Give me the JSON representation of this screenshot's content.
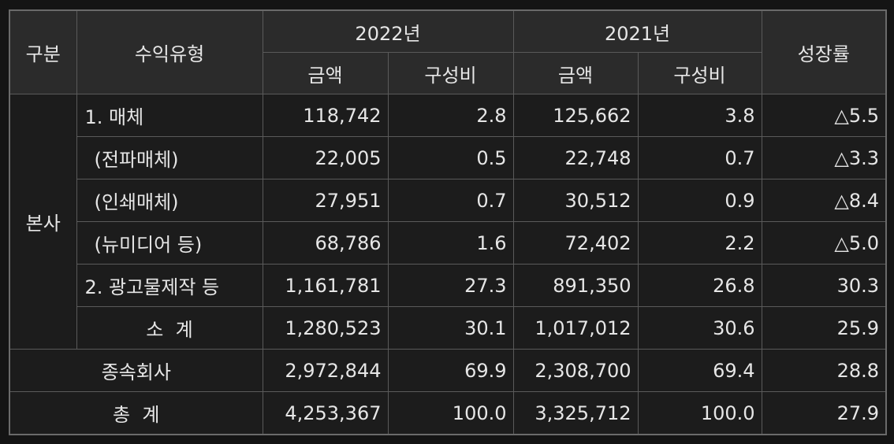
{
  "header": {
    "division": "구분",
    "revenue_type": "수익유형",
    "year_2022": "2022년",
    "year_2021": "2021년",
    "growth": "성장률",
    "amount_2022": "금액",
    "ratio_2022": "구성비",
    "amount_2021": "금액",
    "ratio_2021": "구성비"
  },
  "group_label": "본사",
  "rows": [
    {
      "label": "1. 매체",
      "amt22": "118,742",
      "ratio22": "2.8",
      "amt21": "125,662",
      "ratio21": "3.8",
      "growth": "△5.5"
    },
    {
      "label": "(전파매체)",
      "amt22": "22,005",
      "ratio22": "0.5",
      "amt21": "22,748",
      "ratio21": "0.7",
      "growth": "△3.3"
    },
    {
      "label": "(인쇄매체)",
      "amt22": "27,951",
      "ratio22": "0.7",
      "amt21": "30,512",
      "ratio21": "0.9",
      "growth": "△8.4"
    },
    {
      "label": "(뉴미디어 등)",
      "amt22": "68,786",
      "ratio22": "1.6",
      "amt21": "72,402",
      "ratio21": "2.2",
      "growth": "△5.0"
    },
    {
      "label": "2. 광고물제작 등",
      "amt22": "1,161,781",
      "ratio22": "27.3",
      "amt21": "891,350",
      "ratio21": "26.8",
      "growth": "30.3"
    },
    {
      "label": "소  계",
      "amt22": "1,280,523",
      "ratio22": "30.1",
      "amt21": "1,017,012",
      "ratio21": "30.6",
      "growth": "25.9"
    }
  ],
  "subsidiary": {
    "label": "종속회사",
    "amt22": "2,972,844",
    "ratio22": "69.9",
    "amt21": "2,308,700",
    "ratio21": "69.4",
    "growth": "28.8"
  },
  "total": {
    "label": "총  계",
    "amt22": "4,253,367",
    "ratio22": "100.0",
    "amt21": "3,325,712",
    "ratio21": "100.0",
    "growth": "27.9"
  }
}
